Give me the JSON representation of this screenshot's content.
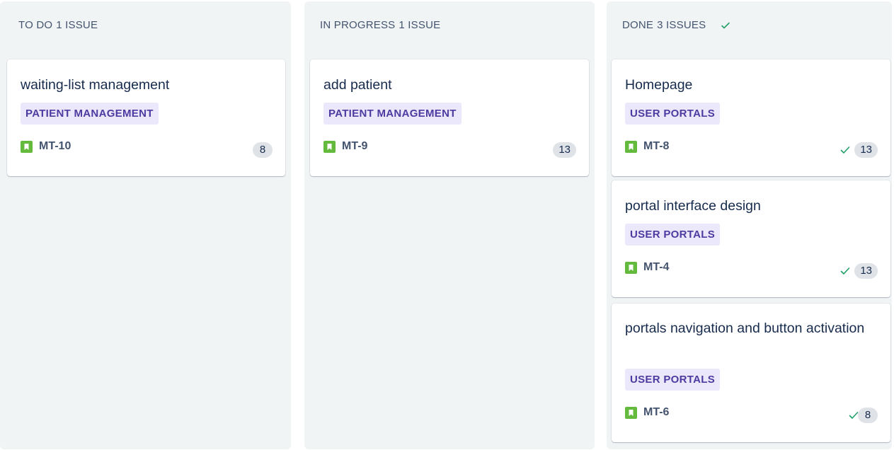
{
  "columns": [
    {
      "name": "TO DO",
      "count": "1 ISSUE",
      "cards": [
        {
          "title": "waiting-list management",
          "label": "PATIENT MANAGEMENT",
          "key": "MT-10",
          "points": "8"
        }
      ]
    },
    {
      "name": "IN PROGRESS",
      "count": "1 ISSUE",
      "cards": [
        {
          "title": "add patient",
          "label": "PATIENT MANAGEMENT",
          "key": "MT-9",
          "points": "13"
        }
      ]
    },
    {
      "name": "DONE",
      "count": "3 ISSUES",
      "cards": [
        {
          "title": "Homepage",
          "label": "USER PORTALS",
          "key": "MT-8",
          "points": "13"
        },
        {
          "title": "portal interface design",
          "label": "USER PORTALS",
          "key": "MT-4",
          "points": "13"
        },
        {
          "title": "portals navigation and button activation",
          "label": "USER PORTALS",
          "key": "MT-6",
          "points": "8"
        }
      ]
    }
  ],
  "colors": {
    "column_bg": "#f1f4f4",
    "label_bg": "#ebe8fb",
    "label_text": "#4e3aa0",
    "story_icon": "#63ba3c",
    "done_check": "#22a06b"
  },
  "icons": {
    "issue_type": "story-icon",
    "column_done": "check-icon",
    "resolved": "check-icon"
  }
}
